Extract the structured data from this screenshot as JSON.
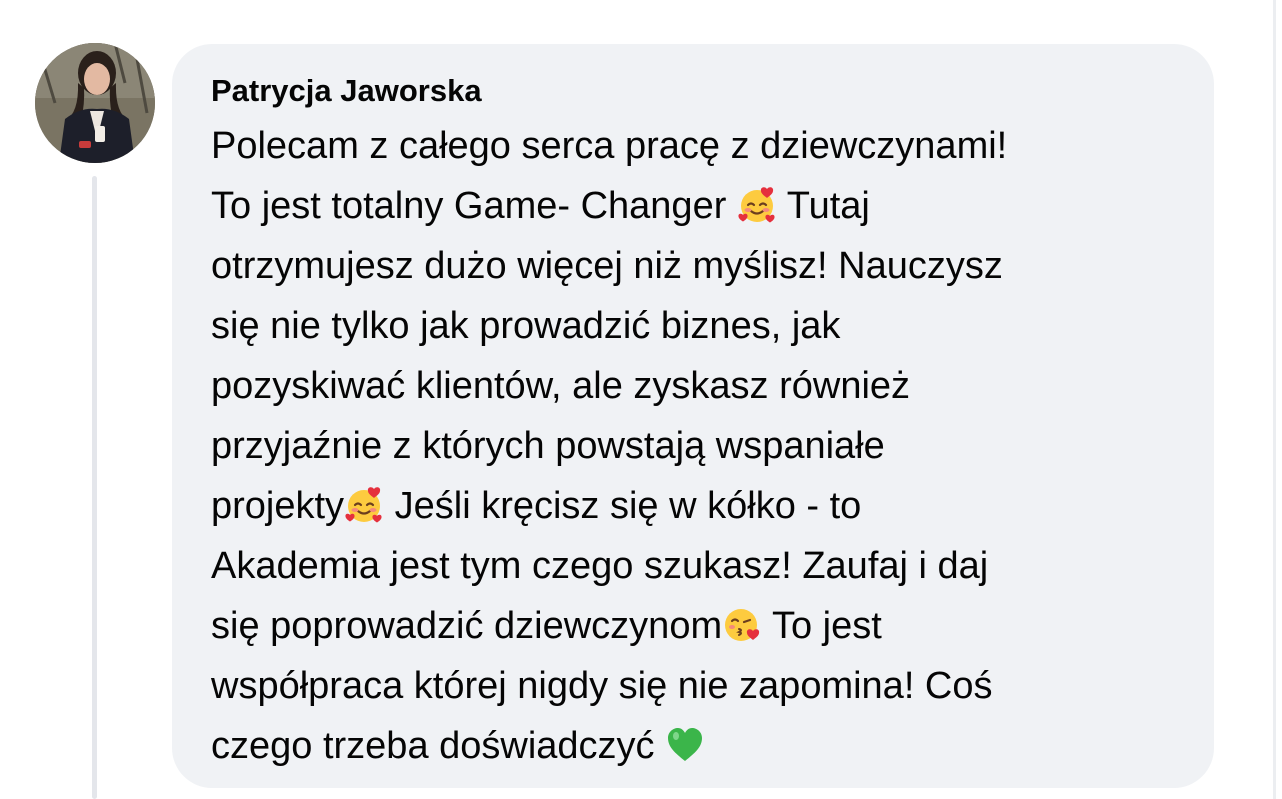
{
  "comment": {
    "author": "Patrycja Jaworska",
    "avatar_icon": "profile-photo",
    "lines": [
      {
        "text": "Polecam z całego serca pracę z dziewczynami!"
      },
      {
        "before": "To jest totalny Game- Changer ",
        "emoji": "smiling-face-with-hearts-emoji",
        "after": " Tutaj"
      },
      {
        "text": "otrzymujesz dużo więcej niż myślisz! Nauczysz"
      },
      {
        "text": "się nie tylko jak prowadzić biznes, jak"
      },
      {
        "text": "pozyskiwać klientów, ale zyskasz również"
      },
      {
        "text": "przyjaźnie z których powstają wspaniałe"
      },
      {
        "before": "projekty",
        "emoji": "smiling-face-with-hearts-emoji",
        "after": " Jeśli kręcisz się w kółko - to"
      },
      {
        "text": "Akademia jest tym czego szukasz! Zaufaj i daj"
      },
      {
        "before": "się poprowadzić dziewczynom",
        "emoji": "face-blowing-a-kiss-emoji",
        "after": " To jest"
      },
      {
        "text": "współpraca której nigdy się nie zapomina! Coś"
      },
      {
        "before": "czego trzeba doświadczyć ",
        "emoji": "green-heart-emoji",
        "after": ""
      }
    ]
  },
  "colors": {
    "bubble_background": "#f0f2f5",
    "text": "#050505",
    "thread_line": "#e4e6eb"
  }
}
